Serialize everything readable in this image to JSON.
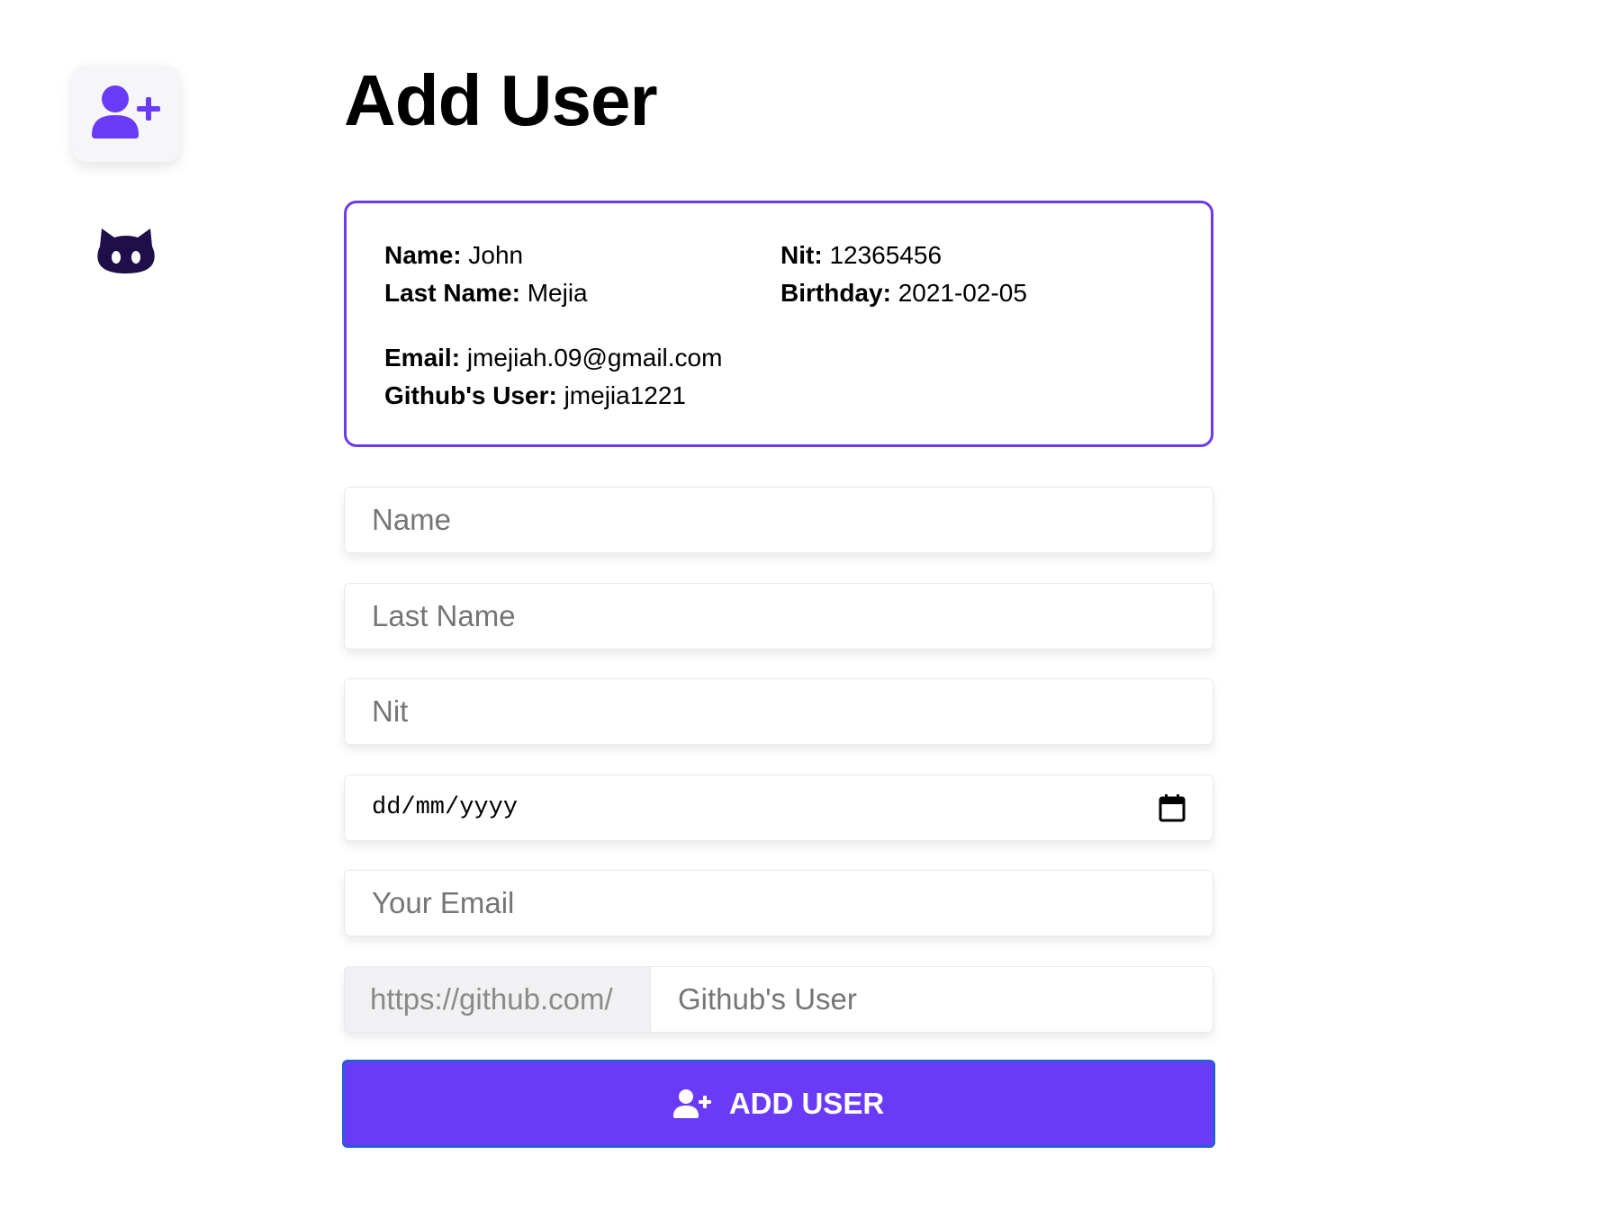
{
  "sidebar": {
    "items": [
      {
        "icon": "add-user-icon",
        "color": "#6a3bf7"
      },
      {
        "icon": "github-icon",
        "color": "#1e0f4a"
      }
    ]
  },
  "page": {
    "title": "Add User"
  },
  "summary": {
    "name_label": "Name:",
    "name_value": "John",
    "last_name_label": "Last Name:",
    "last_name_value": "Mejia",
    "nit_label": "Nit:",
    "nit_value": "12365456",
    "birthday_label": "Birthday:",
    "birthday_value": "2021-02-05",
    "email_label": "Email:",
    "email_value": "jmejiah.09@gmail.com",
    "github_label": "Github's User:",
    "github_value": "jmejia1221"
  },
  "form": {
    "name_placeholder": "Name",
    "last_name_placeholder": "Last Name",
    "nit_placeholder": "Nit",
    "date_placeholder": "dd/mm/yyyy",
    "email_placeholder": "Your Email",
    "github_prefix": "https://github.com/",
    "github_placeholder": "Github's User",
    "submit_label": "ADD USER"
  },
  "colors": {
    "accent": "#6a3bf7",
    "card_border": "#6a3be6",
    "button_border": "#2a5bd8"
  }
}
